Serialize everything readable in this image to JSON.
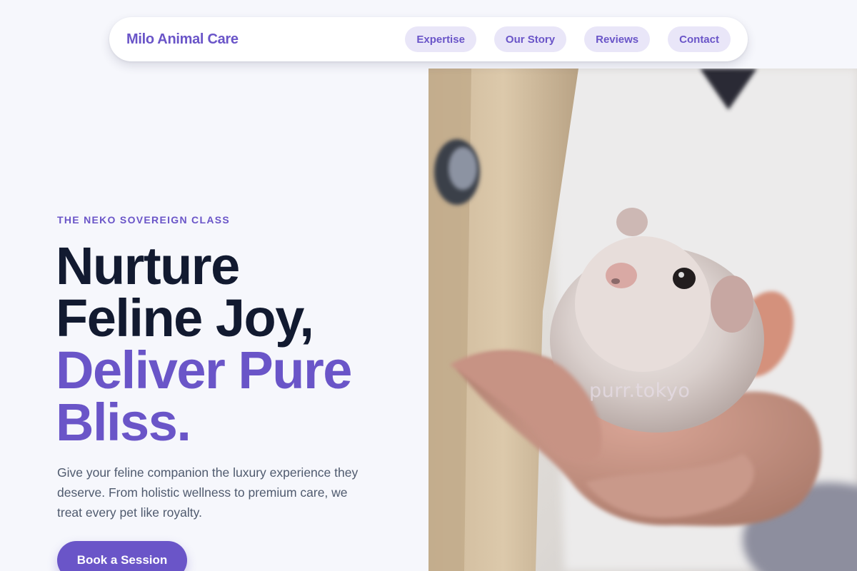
{
  "nav": {
    "brand": "Milo Animal Care",
    "links": [
      {
        "label": "Expertise"
      },
      {
        "label": "Our Story"
      },
      {
        "label": "Reviews"
      },
      {
        "label": "Contact"
      }
    ]
  },
  "hero": {
    "eyebrow": "THE NEKO SOVEREIGN CLASS",
    "headline_line1": "Nurture",
    "headline_line2": "Feline Joy,",
    "headline_line3": "Deliver Pure",
    "headline_line4": "Bliss.",
    "description": "Give your feline companion the luxury experience they deserve. From holistic wellness to premium care, we treat every pet like royalty.",
    "cta_label": "Book a Session"
  },
  "photo": {
    "subject": "hamster-in-hand-photo",
    "watermark": "purr.tokyo"
  },
  "colors": {
    "accent": "#6a55c8",
    "headline_dark": "#121a30",
    "pill_bg": "#e9e6f8",
    "page_bg": "#f6f7fc",
    "body_text": "#4f5a6e"
  }
}
